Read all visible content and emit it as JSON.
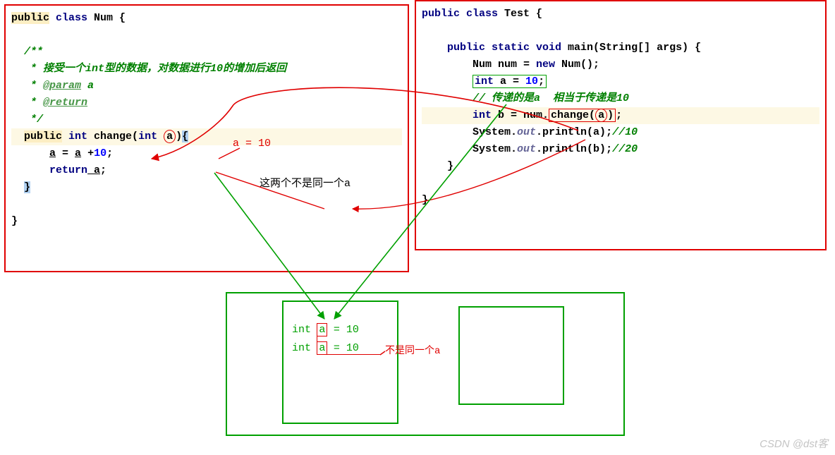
{
  "left_code": {
    "l1a": "public",
    "l1b": " class",
    "l1c": " Num {",
    "c1": "/**",
    "c2a": " * 接受一个",
    "c2b": "int",
    "c2c": "型的数据，对数据进行",
    "c2d": "10",
    "c2e": "的增加后返回",
    "c3a": " * ",
    "c3b": "@param",
    "c3c": " a",
    "c4a": " * ",
    "c4b": "@return",
    "c5": " */",
    "m1a": "public",
    "m1b": " int",
    "m1c": " change(",
    "m1d": "int ",
    "m1e": "a",
    "m1f": ")",
    "m1g": "{",
    "m2a": "a",
    "m2b": " = ",
    "m2c": "a",
    "m2d": " +",
    "m2e": "10",
    "m2f": ";",
    "m3a": "return",
    "m3b": " a",
    "m3c": ";",
    "m4": "}",
    "end": "}"
  },
  "right_code": {
    "l1a": "public class",
    "l1b": " Test {",
    "m1a": "public static void",
    "m1b": " main(String[] args) {",
    "s1a": "Num num = ",
    "s1b": "new",
    "s1c": " Num();",
    "s2a": "int",
    "s2b": " a = ",
    "s2c": "10",
    "s2d": ";",
    "s3": "// 传递的是a  相当于传递是10",
    "s4a": "int",
    "s4b": " b = num.",
    "s4c": "change(",
    "s4d": "a",
    "s4e": ")",
    "s4f": ";",
    "s5a": "System.",
    "s5b": "out",
    "s5c": ".println(a);",
    "s5d": "//10",
    "s6a": "System.",
    "s6b": "out",
    "s6c": ".println(b);",
    "s6d": "//20",
    "m9": "}",
    "end": "}"
  },
  "annot": {
    "a_eq_10": "a = 10",
    "not_same_a": "这两个不是同一个a",
    "not_same_a2": "不是同一个a"
  },
  "mem": {
    "r1a": "int",
    "r1b": "a",
    "r1c": "= 10",
    "r2a": "int",
    "r2b": "a",
    "r2c": "= 10"
  },
  "watermark": "CSDN @dst客"
}
